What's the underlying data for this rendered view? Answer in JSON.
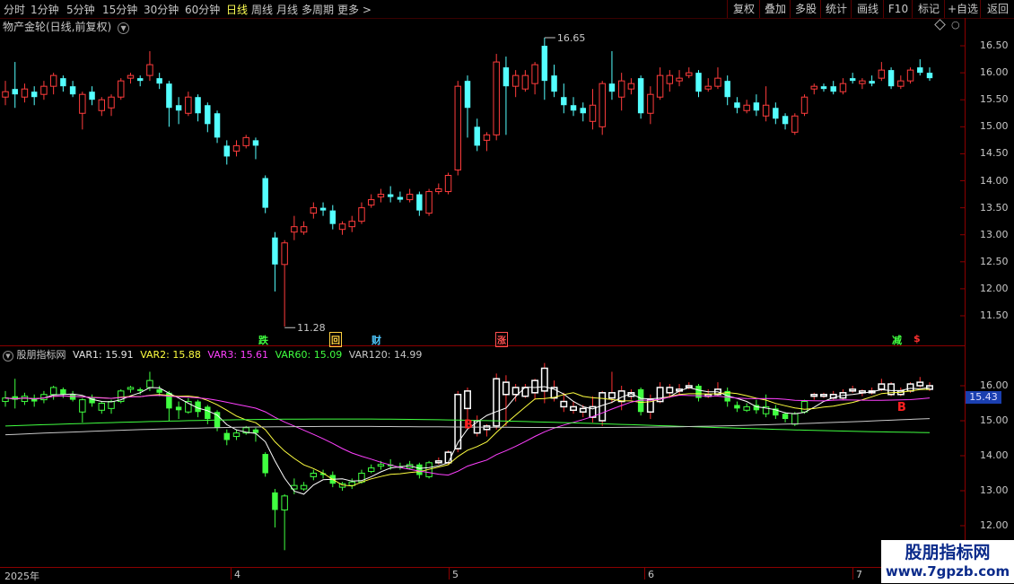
{
  "toolbar": {
    "periods": [
      "分时",
      "1分钟",
      "5分钟",
      "15分钟",
      "30分钟",
      "60分钟",
      "日线",
      "周线",
      "月线",
      "多周期",
      "更多 >"
    ],
    "active_period": "日线",
    "right": [
      "复权",
      "叠加",
      "多股",
      "统计",
      "画线",
      "F10",
      "标记",
      "+自选",
      "返回"
    ]
  },
  "main_title": "物产金轮(日线,前复权)",
  "sub_title": {
    "name": "股朋指标网",
    "var1": "VAR1: 15.91",
    "var2": "VAR2: 15.88",
    "var3": "VAR3: 15.61",
    "var60": "VAR60: 15.09",
    "var120": "VAR120: 14.99"
  },
  "current_value": "15.43",
  "dates": [
    "2025年",
    "4",
    "5",
    "6",
    "7"
  ],
  "events": {
    "e1": "跌",
    "e2": "回",
    "e3": "财",
    "e4": "涨",
    "e5": "减",
    "e6": "$"
  },
  "watermark": {
    "text1": "股朋指标网",
    "text2": "www.7gpzb.com"
  },
  "chart_data": [
    {
      "type": "candlestick",
      "title": "物产金轮(日线,前复权)",
      "yticks": [
        11.5,
        12.0,
        12.5,
        13.0,
        13.5,
        14.0,
        14.5,
        15.0,
        15.5,
        16.0,
        16.5
      ],
      "ylim": [
        11.2,
        16.8
      ],
      "annotations": [
        {
          "label": "16.65",
          "value": 16.65
        },
        {
          "label": "11.28",
          "value": 11.28
        }
      ],
      "candles": [
        [
          15.55,
          15.65,
          15.4,
          15.85
        ],
        [
          15.7,
          15.6,
          15.35,
          16.2
        ],
        [
          15.55,
          15.7,
          15.45,
          15.8
        ],
        [
          15.65,
          15.55,
          15.4,
          15.75
        ],
        [
          15.6,
          15.75,
          15.5,
          15.85
        ],
        [
          15.75,
          15.95,
          15.6,
          16.0
        ],
        [
          15.9,
          15.75,
          15.65,
          15.95
        ],
        [
          15.75,
          15.6,
          15.55,
          15.85
        ],
        [
          15.25,
          15.6,
          14.95,
          15.65
        ],
        [
          15.65,
          15.5,
          15.4,
          15.75
        ],
        [
          15.3,
          15.5,
          15.2,
          15.55
        ],
        [
          15.35,
          15.55,
          15.2,
          15.6
        ],
        [
          15.55,
          15.85,
          15.5,
          15.9
        ],
        [
          15.9,
          15.95,
          15.8,
          16.0
        ],
        [
          15.9,
          15.85,
          15.75,
          15.95
        ],
        [
          15.95,
          16.15,
          15.85,
          16.4
        ],
        [
          15.9,
          15.8,
          15.7,
          16.0
        ],
        [
          15.8,
          15.35,
          15.0,
          15.85
        ],
        [
          15.4,
          15.3,
          15.05,
          15.55
        ],
        [
          15.25,
          15.55,
          15.2,
          15.65
        ],
        [
          15.55,
          15.25,
          15.1,
          15.6
        ],
        [
          15.4,
          15.05,
          14.9,
          15.45
        ],
        [
          15.25,
          14.8,
          14.7,
          15.3
        ],
        [
          14.65,
          14.45,
          14.3,
          14.75
        ],
        [
          14.55,
          14.65,
          14.45,
          14.75
        ],
        [
          14.65,
          14.8,
          14.6,
          14.85
        ],
        [
          14.75,
          14.65,
          14.4,
          14.8
        ],
        [
          14.05,
          13.5,
          13.4,
          14.1
        ],
        [
          12.95,
          12.45,
          11.95,
          13.05
        ],
        [
          12.45,
          12.85,
          11.3,
          12.9
        ],
        [
          13.05,
          13.15,
          12.9,
          13.35
        ],
        [
          13.05,
          13.15,
          13.0,
          13.25
        ],
        [
          13.4,
          13.5,
          13.3,
          13.6
        ],
        [
          13.5,
          13.45,
          13.35,
          13.6
        ],
        [
          13.45,
          13.2,
          13.1,
          13.55
        ],
        [
          13.1,
          13.2,
          13.0,
          13.25
        ],
        [
          13.15,
          13.25,
          13.05,
          13.35
        ],
        [
          13.25,
          13.5,
          13.2,
          13.6
        ],
        [
          13.55,
          13.65,
          13.5,
          13.75
        ],
        [
          13.7,
          13.75,
          13.6,
          13.85
        ],
        [
          13.75,
          13.7,
          13.6,
          13.9
        ],
        [
          13.7,
          13.65,
          13.6,
          13.8
        ],
        [
          13.65,
          13.75,
          13.6,
          13.85
        ],
        [
          13.75,
          13.45,
          13.35,
          13.8
        ],
        [
          13.4,
          13.8,
          13.35,
          13.85
        ],
        [
          13.8,
          13.85,
          13.75,
          13.95
        ],
        [
          13.8,
          14.1,
          13.75,
          14.15
        ],
        [
          14.2,
          15.75,
          14.1,
          15.85
        ],
        [
          15.85,
          15.35,
          14.8,
          15.95
        ],
        [
          15.0,
          14.65,
          14.55,
          15.15
        ],
        [
          14.75,
          14.85,
          14.55,
          14.9
        ],
        [
          14.85,
          16.2,
          14.75,
          16.35
        ],
        [
          16.1,
          15.75,
          14.85,
          16.3
        ],
        [
          15.75,
          15.95,
          15.55,
          16.05
        ],
        [
          15.7,
          15.95,
          15.65,
          16.05
        ],
        [
          15.8,
          16.15,
          15.6,
          16.2
        ],
        [
          16.5,
          15.85,
          15.5,
          16.65
        ],
        [
          15.95,
          15.65,
          15.55,
          16.15
        ],
        [
          15.55,
          15.4,
          15.25,
          15.8
        ],
        [
          15.4,
          15.3,
          15.2,
          15.55
        ],
        [
          15.35,
          15.25,
          15.1,
          15.45
        ],
        [
          15.1,
          15.4,
          14.95,
          15.7
        ],
        [
          15.0,
          15.8,
          14.85,
          15.85
        ],
        [
          15.8,
          15.65,
          15.5,
          16.4
        ],
        [
          15.55,
          15.85,
          15.3,
          16.0
        ],
        [
          15.7,
          15.8,
          15.6,
          15.9
        ],
        [
          15.9,
          15.25,
          15.15,
          15.95
        ],
        [
          15.25,
          15.6,
          15.05,
          15.75
        ],
        [
          15.55,
          15.95,
          15.5,
          16.1
        ],
        [
          15.8,
          15.95,
          15.65,
          16.05
        ],
        [
          15.85,
          15.9,
          15.75,
          16.05
        ],
        [
          15.95,
          16.0,
          15.9,
          16.1
        ],
        [
          16.0,
          15.65,
          15.55,
          16.05
        ],
        [
          15.7,
          15.75,
          15.65,
          15.9
        ],
        [
          15.75,
          15.9,
          15.7,
          16.1
        ],
        [
          15.85,
          15.55,
          15.4,
          15.95
        ],
        [
          15.45,
          15.35,
          15.25,
          15.55
        ],
        [
          15.3,
          15.4,
          15.25,
          15.5
        ],
        [
          15.45,
          15.3,
          15.2,
          15.6
        ],
        [
          15.2,
          15.4,
          15.1,
          15.75
        ],
        [
          15.35,
          15.15,
          15.05,
          15.45
        ],
        [
          15.2,
          15.05,
          14.95,
          15.25
        ],
        [
          14.9,
          15.2,
          14.85,
          15.25
        ],
        [
          15.25,
          15.55,
          15.2,
          15.6
        ],
        [
          15.7,
          15.75,
          15.6,
          15.8
        ],
        [
          15.75,
          15.7,
          15.65,
          15.8
        ],
        [
          15.75,
          15.65,
          15.6,
          15.85
        ],
        [
          15.65,
          15.8,
          15.6,
          15.9
        ],
        [
          15.9,
          15.85,
          15.8,
          16.0
        ],
        [
          15.8,
          15.85,
          15.7,
          15.9
        ],
        [
          15.85,
          15.8,
          15.75,
          15.95
        ],
        [
          15.9,
          16.05,
          15.85,
          16.2
        ],
        [
          16.05,
          15.75,
          15.7,
          16.1
        ],
        [
          15.75,
          15.85,
          15.7,
          15.95
        ],
        [
          15.85,
          16.05,
          15.8,
          16.1
        ],
        [
          16.1,
          16.0,
          15.95,
          16.25
        ],
        [
          16.0,
          15.9,
          15.85,
          16.1
        ]
      ]
    },
    {
      "type": "candlestick",
      "title": "股朋指标网",
      "yticks": [
        12.0,
        13.0,
        14.0,
        15.0,
        16.0
      ],
      "ylim": [
        11.8,
        16.8
      ],
      "series": [
        {
          "name": "VAR1",
          "value": 15.91
        },
        {
          "name": "VAR2",
          "value": 15.88
        },
        {
          "name": "VAR3",
          "value": 15.61
        },
        {
          "name": "VAR60",
          "value": 15.09
        },
        {
          "name": "VAR120",
          "value": 14.99
        }
      ],
      "markers": [
        {
          "label": "B",
          "at": 48
        },
        {
          "label": "B",
          "at": 93
        }
      ],
      "current": 15.43
    }
  ]
}
